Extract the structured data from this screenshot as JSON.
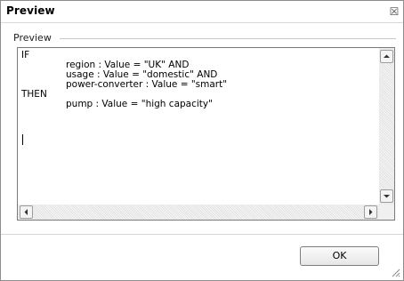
{
  "window": {
    "title": "Preview",
    "close_glyph": "☒"
  },
  "group": {
    "label": "Preview"
  },
  "rule": {
    "lines": [
      "IF",
      "region : Value = \"UK\" AND",
      "usage : Value = \"domestic\" AND",
      "power-converter : Value = \"smart\"",
      "THEN",
      "pump : Value = \"high capacity\""
    ]
  },
  "buttons": {
    "ok_label": "OK"
  },
  "icons": {
    "close": "close-icon",
    "scroll_up": "arrow-up-icon",
    "scroll_down": "arrow-down-icon",
    "scroll_left": "arrow-left-icon",
    "scroll_right": "arrow-right-icon",
    "resize": "resize-grip-icon"
  }
}
